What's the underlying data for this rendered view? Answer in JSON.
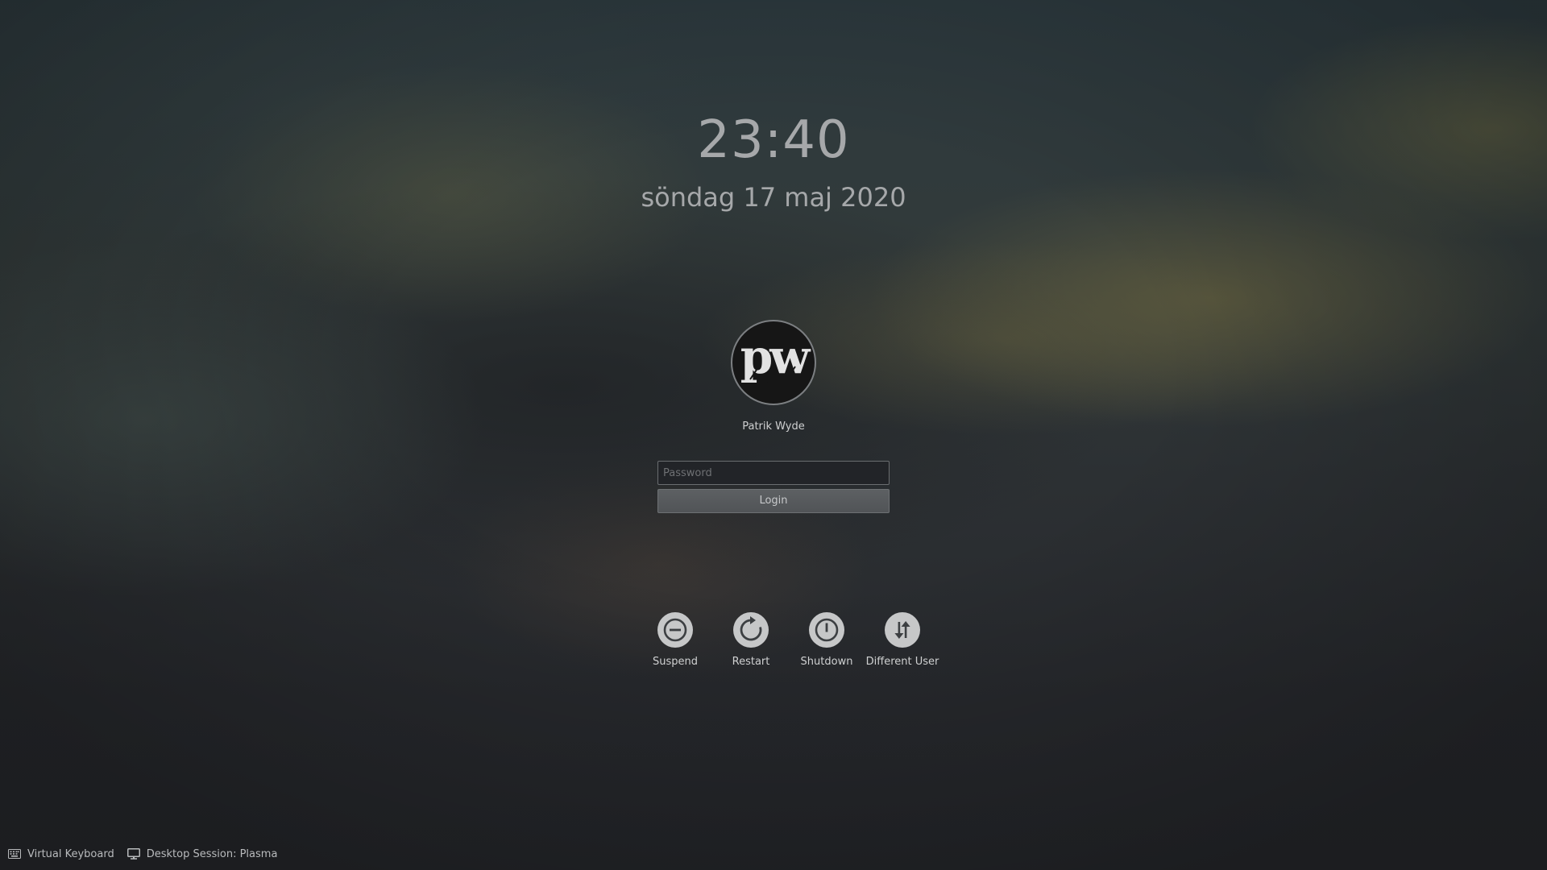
{
  "clock": {
    "time": "23:40",
    "date": "söndag 17 maj 2020"
  },
  "user": {
    "name": "Patrik Wyde",
    "avatar_monogram": "pw"
  },
  "login_form": {
    "password_placeholder": "Password",
    "password_value": "",
    "login_label": "Login"
  },
  "actions": [
    {
      "label": "Suspend",
      "icon": "suspend-icon"
    },
    {
      "label": "Restart",
      "icon": "restart-icon"
    },
    {
      "label": "Shutdown",
      "icon": "shutdown-icon"
    },
    {
      "label": "Different User",
      "icon": "switch-user-icon"
    }
  ],
  "footer": {
    "virtual_keyboard_label": "Virtual Keyboard",
    "virtual_keyboard_icon": "keyboard-icon",
    "session_label": "Desktop Session: Plasma",
    "session_icon": "monitor-icon"
  },
  "colors": {
    "text": "#cfd0d1",
    "clock_text": "#a6a8aa",
    "action_circle": "#c6c7c8",
    "field_background": "#222428",
    "button_background": "#595c5f"
  }
}
